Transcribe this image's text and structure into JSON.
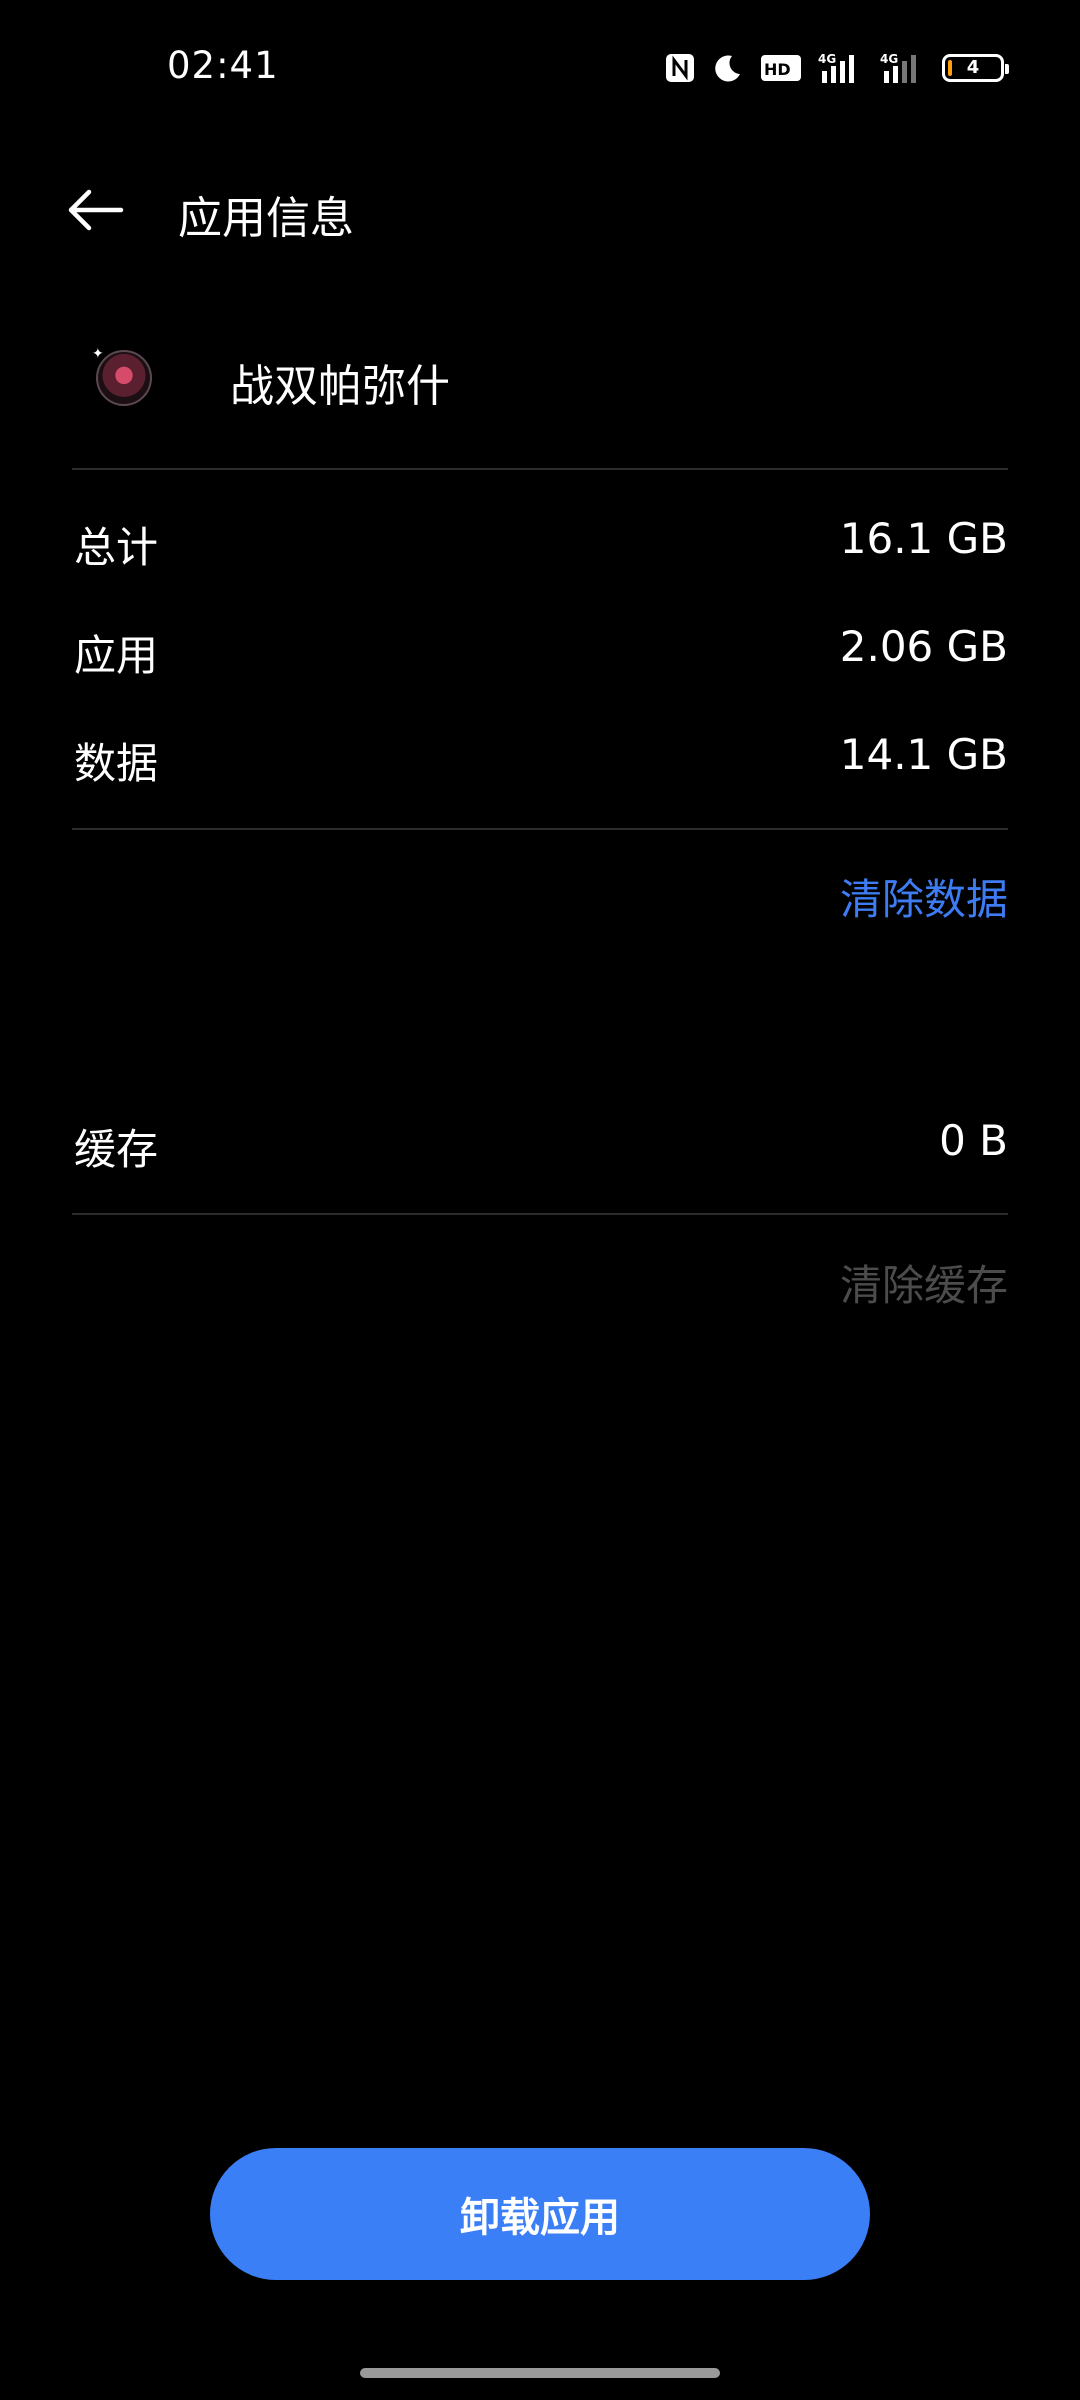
{
  "status_bar": {
    "time": "02:41",
    "battery_level": "4",
    "hd_label": "HD",
    "net_label_1": "4G",
    "net_label_2": "4G",
    "icons": [
      "nfc-icon",
      "moon-icon",
      "hd-voice-icon",
      "signal-4g-icon",
      "signal-4g-icon",
      "battery-icon"
    ]
  },
  "header": {
    "title": "应用信息",
    "back_icon": "arrow-left-icon"
  },
  "app": {
    "name": "战双帕弥什",
    "icon": "app-icon"
  },
  "storage": {
    "total_label": "总计",
    "total_value": "16.1 GB",
    "app_label": "应用",
    "app_value": "2.06 GB",
    "data_label": "数据",
    "data_value": "14.1 GB",
    "clear_data": "清除数据",
    "cache_label": "缓存",
    "cache_value": "0 B",
    "clear_cache": "清除缓存"
  },
  "footer": {
    "uninstall": "卸载应用"
  },
  "colors": {
    "background": "#000000",
    "accent": "#3a7ff6",
    "link": "#3d7cf2",
    "disabled": "#4c4c4c"
  }
}
